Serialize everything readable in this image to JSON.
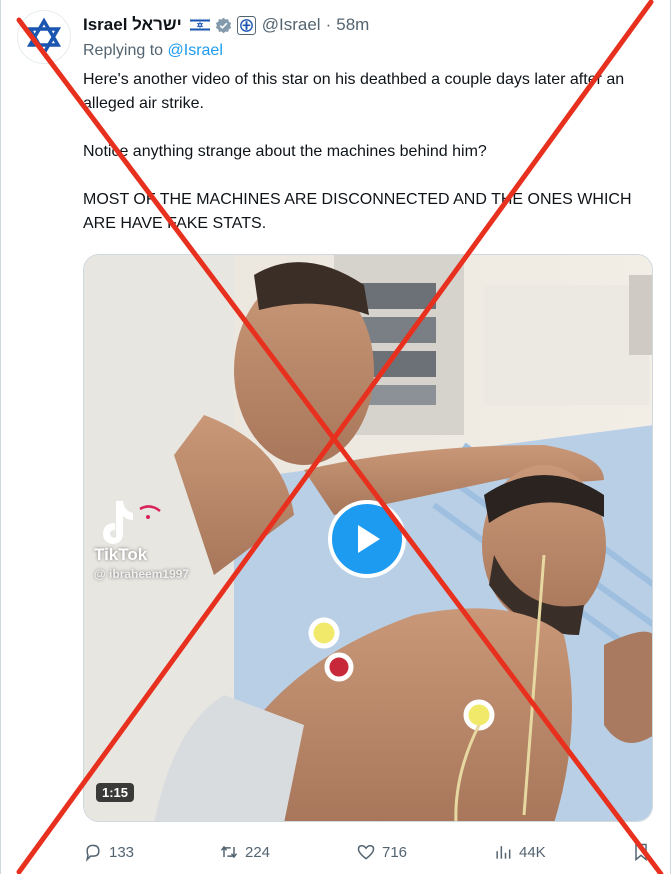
{
  "tweet": {
    "display_name": "Israel ישראל",
    "handle": "@Israel",
    "separator": "·",
    "time": "58m",
    "replying_prefix": "Replying to",
    "replying_handle": "@Israel",
    "paragraphs": [
      "Here's another video of this star on his deathbed a couple days later after an alleged air strike.",
      "Notice anything strange about the machines behind him?",
      "MOST OF THE MACHINES ARE DISCONNECTED AND THE ONES WHICH ARE HAVE FAKE STATS."
    ]
  },
  "media": {
    "watermark_name": "TikTok",
    "watermark_user": "@ ibraheem1997",
    "duration": "1:15"
  },
  "actions": {
    "replies": "133",
    "reposts": "224",
    "likes": "716",
    "views": "44K"
  },
  "icons": {
    "avatar": "star-of-david-icon",
    "flag": "israel-flag-icon",
    "verified": "verified-badge-icon",
    "affiliation": "government-emblem-icon",
    "reply": "reply-icon",
    "repost": "repost-icon",
    "like": "heart-icon",
    "views": "views-chart-icon",
    "bookmark": "bookmark-icon",
    "play": "play-icon",
    "overlay": "red-x-cross"
  },
  "colors": {
    "accent": "#1d9bf0",
    "text": "#0f1419",
    "secondary": "#536471",
    "cross": "#e8301f"
  }
}
